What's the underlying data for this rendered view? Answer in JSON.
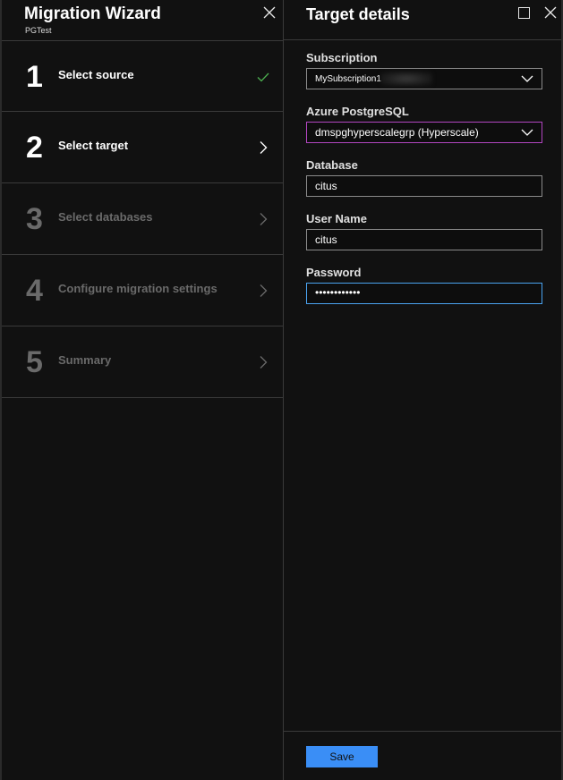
{
  "wizard": {
    "title": "Migration Wizard",
    "subtitle": "PGTest",
    "close_icon": "close-icon",
    "steps": [
      {
        "number": "1",
        "label": "Select source",
        "state": "complete",
        "icon": "checkmark-icon"
      },
      {
        "number": "2",
        "label": "Select target",
        "state": "active",
        "icon": "chevron-right-icon"
      },
      {
        "number": "3",
        "label": "Select databases",
        "state": "disabled",
        "icon": "chevron-right-icon"
      },
      {
        "number": "4",
        "label": "Configure migration settings",
        "state": "disabled",
        "icon": "chevron-right-icon"
      },
      {
        "number": "5",
        "label": "Summary",
        "state": "disabled",
        "icon": "chevron-right-icon"
      }
    ]
  },
  "target": {
    "title": "Target details",
    "fields": {
      "subscription": {
        "label": "Subscription",
        "value": "MySubscription1"
      },
      "postgresql": {
        "label": "Azure PostgreSQL",
        "value": "dmspghyperscalegrp (Hyperscale)"
      },
      "database": {
        "label": "Database",
        "value": "citus"
      },
      "username": {
        "label": "User Name",
        "value": "citus"
      },
      "password": {
        "label": "Password",
        "value": "••••••••••••"
      }
    },
    "save_label": "Save"
  },
  "colors": {
    "background": "#111111",
    "accent": "#3a8ef6",
    "check": "#4caf50",
    "highlight_border": "#b246c0",
    "focus_border": "#4aa3f0"
  }
}
